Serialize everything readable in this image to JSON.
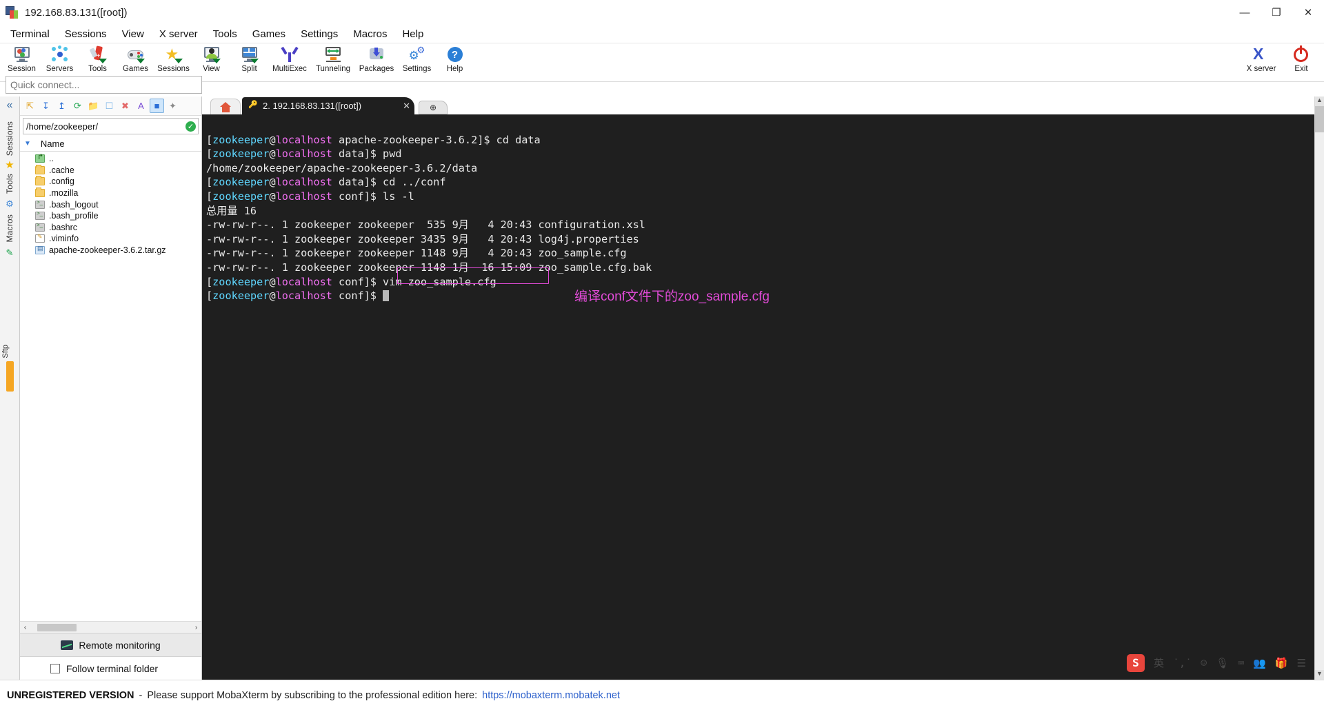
{
  "window": {
    "title": "192.168.83.131([root])",
    "icon": "mobaxterm-icon",
    "minimize": "—",
    "maximize": "❐",
    "close": "✕"
  },
  "menubar": {
    "items": [
      "Terminal",
      "Sessions",
      "View",
      "X server",
      "Tools",
      "Games",
      "Settings",
      "Macros",
      "Help"
    ]
  },
  "toolbar": {
    "buttons": [
      {
        "label": "Session",
        "icon": "session-icon"
      },
      {
        "label": "Servers",
        "icon": "servers-icon"
      },
      {
        "label": "Tools",
        "icon": "tools-icon"
      },
      {
        "label": "Games",
        "icon": "games-icon"
      },
      {
        "label": "Sessions",
        "icon": "sessions-star-icon"
      },
      {
        "label": "View",
        "icon": "view-icon"
      },
      {
        "label": "Split",
        "icon": "split-icon"
      },
      {
        "label": "MultiExec",
        "icon": "multiexec-icon"
      },
      {
        "label": "Tunneling",
        "icon": "tunneling-icon"
      },
      {
        "label": "Packages",
        "icon": "packages-icon"
      },
      {
        "label": "Settings",
        "icon": "settings-gear-icon"
      },
      {
        "label": "Help",
        "icon": "help-question-icon"
      }
    ],
    "right_buttons": [
      {
        "label": "X server",
        "icon": "xserver-icon"
      },
      {
        "label": "Exit",
        "icon": "exit-power-icon"
      }
    ]
  },
  "quick_connect": {
    "placeholder": "Quick connect...",
    "value": ""
  },
  "left_ribbon": {
    "collapse_icon": "«",
    "tabs": [
      "Sessions",
      "Tools",
      "Macros"
    ],
    "sftp_label": "Sftp"
  },
  "sidebar": {
    "toolbar_icons": [
      "go-up-folder-icon",
      "download-icon",
      "upload-icon",
      "refresh-icon",
      "new-folder-icon",
      "new-file-icon",
      "delete-icon",
      "text-mode-icon",
      "binary-mode-icon",
      "edit-wand-icon"
    ],
    "path": "/home/zookeeper/",
    "path_status": "✓",
    "column_header": "Name",
    "sort_arrow": "▼",
    "files": [
      {
        "name": "..",
        "type": "up"
      },
      {
        "name": ".cache",
        "type": "folder"
      },
      {
        "name": ".config",
        "type": "folder"
      },
      {
        "name": ".mozilla",
        "type": "folder"
      },
      {
        "name": ".bash_logout",
        "type": "sh"
      },
      {
        "name": ".bash_profile",
        "type": "sh"
      },
      {
        "name": ".bashrc",
        "type": "sh"
      },
      {
        "name": ".viminfo",
        "type": "doc"
      },
      {
        "name": "apache-zookeeper-3.6.2.tar.gz",
        "type": "arch"
      }
    ],
    "hscroll": {
      "left_arrow": "‹",
      "right_arrow": "›"
    },
    "remote_monitoring": "Remote monitoring",
    "follow_terminal_folder": "Follow terminal folder",
    "follow_checked": false
  },
  "tabs": {
    "home_icon": "home-icon",
    "active": {
      "label": "2. 192.168.83.131([root])",
      "close": "✕",
      "icon": "key-icon"
    },
    "add_label": "⊕"
  },
  "terminal": {
    "prompt_user": "zookeeper",
    "prompt_at": "@",
    "prompt_host": "localhost",
    "lines": [
      {
        "host_prompt": true,
        "cwd": "apache-zookeeper-3.6.2",
        "cmd": "cd data"
      },
      {
        "host_prompt": true,
        "cwd": "data",
        "cmd": "pwd"
      },
      {
        "plain": "/home/zookeeper/apache-zookeeper-3.6.2/data"
      },
      {
        "host_prompt": true,
        "cwd": "data",
        "cmd": "cd ../conf"
      },
      {
        "host_prompt": true,
        "cwd": "conf",
        "cmd": "ls -l"
      },
      {
        "plain": "总用量 16"
      },
      {
        "plain": "-rw-rw-r--. 1 zookeeper zookeeper  535 9月   4 20:43 configuration.xsl"
      },
      {
        "plain": "-rw-rw-r--. 1 zookeeper zookeeper 3435 9月   4 20:43 log4j.properties"
      },
      {
        "plain": "-rw-rw-r--. 1 zookeeper zookeeper 1148 9月   4 20:43 zoo_sample.cfg"
      },
      {
        "plain": "-rw-rw-r--. 1 zookeeper zookeeper 1148 1月  16 15:09 zoo_sample.cfg.bak"
      },
      {
        "host_prompt": true,
        "cwd": "conf",
        "cmd": "vim zoo_sample.cfg",
        "highlight": true
      },
      {
        "host_prompt": true,
        "cwd": "conf",
        "cmd": "",
        "cursor": true
      }
    ],
    "annotation": "编译conf文件下的zoo_sample.cfg",
    "annotation_color": "#e24bd8",
    "highlight_color": "#e24bd8",
    "scrollbar": {
      "up": "▲",
      "down": "▼"
    }
  },
  "ime_tray": {
    "logo": "S",
    "items": [
      "英",
      "˙,˙",
      "☺",
      "🎙",
      "⌨",
      "👥",
      "🎁",
      "☰"
    ]
  },
  "footer": {
    "unregistered": "UNREGISTERED VERSION",
    "dash": "-",
    "message": "Please support MobaXterm by subscribing to the professional edition here:",
    "link": "https://mobaxterm.mobatek.net"
  }
}
